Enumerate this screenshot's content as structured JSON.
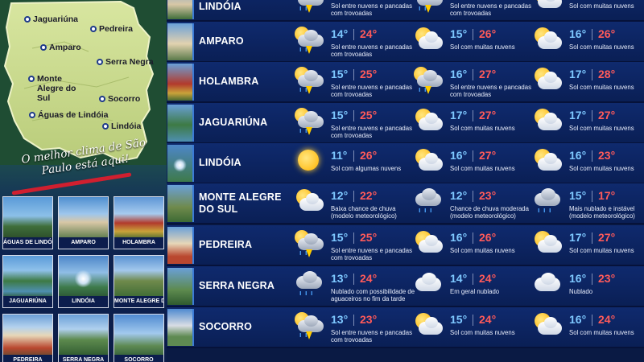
{
  "colors": {
    "min_temp": "#7ec8ff",
    "max_temp": "#ff5a5a",
    "background": "#0a1a44",
    "map_green": "#c8d98a",
    "ribbon": "#d01f2f"
  },
  "map": {
    "cities": [
      "Jaguariúna",
      "Pedreira",
      "Amparo",
      "Serra Negra",
      "Monte Alegre do Sul",
      "Socorro",
      "Águas de Lindóia",
      "Lindóia"
    ]
  },
  "slogan": "O melhor clima de São Paulo está aqui!",
  "thumbnails": [
    "ÁGUAS DE LINDÓIA",
    "AMPARO",
    "HOLAMBRA",
    "JAGUARIÚNA",
    "LINDÓIA",
    "MONTE ALEGRE DO SUL",
    "PEDREIRA",
    "SERRA NEGRA",
    "SOCORRO"
  ],
  "rows": [
    {
      "name": "ÁGUAS DE LINDÓIA",
      "days": [
        {
          "icon": "sun-cloud-storm-icon",
          "min": "",
          "max": "",
          "desc": "Sol entre nuvens e pancadas com trovoadas"
        },
        {
          "icon": "sun-cloud-storm-icon",
          "min": "",
          "max": "",
          "desc": "Sol entre nuvens e pancadas com trovoadas"
        },
        {
          "icon": "sun-cloud-icon",
          "min": "",
          "max": "",
          "desc": "Sol com muitas nuvens"
        }
      ]
    },
    {
      "name": "AMPARO",
      "days": [
        {
          "icon": "sun-cloud-storm-icon",
          "min": "14°",
          "max": "24°",
          "desc": "Sol entre nuvens e pancadas com trovoadas"
        },
        {
          "icon": "sun-cloud-icon",
          "min": "15°",
          "max": "26°",
          "desc": "Sol com muitas nuvens"
        },
        {
          "icon": "sun-cloud-icon",
          "min": "16°",
          "max": "26°",
          "desc": "Sol com muitas nuvens"
        }
      ]
    },
    {
      "name": "HOLAMBRA",
      "days": [
        {
          "icon": "sun-cloud-storm-icon",
          "min": "15°",
          "max": "25°",
          "desc": "Sol entre nuvens e pancadas com trovoadas"
        },
        {
          "icon": "sun-cloud-storm-icon",
          "min": "16°",
          "max": "27°",
          "desc": "Sol entre nuvens e pancadas com trovoadas"
        },
        {
          "icon": "sun-cloud-icon",
          "min": "17°",
          "max": "28°",
          "desc": "Sol com muitas nuvens"
        }
      ]
    },
    {
      "name": "JAGUARIÚNA",
      "days": [
        {
          "icon": "sun-cloud-storm-icon",
          "min": "15°",
          "max": "25°",
          "desc": "Sol entre nuvens e pancadas com trovoadas"
        },
        {
          "icon": "sun-cloud-icon",
          "min": "17°",
          "max": "27°",
          "desc": "Sol com muitas nuvens"
        },
        {
          "icon": "sun-cloud-icon",
          "min": "17°",
          "max": "27°",
          "desc": "Sol com muitas nuvens"
        }
      ]
    },
    {
      "name": "LINDÓIA",
      "days": [
        {
          "icon": "sun-icon",
          "min": "11°",
          "max": "26°",
          "desc": "Sol com algumas nuvens"
        },
        {
          "icon": "sun-cloud-icon",
          "min": "16°",
          "max": "27°",
          "desc": "Sol com muitas nuvens"
        },
        {
          "icon": "sun-cloud-icon",
          "min": "16°",
          "max": "23°",
          "desc": "Sol com muitas nuvens"
        }
      ]
    },
    {
      "name": "MONTE ALEGRE DO SUL",
      "days": [
        {
          "icon": "sun-cloud-icon",
          "min": "12°",
          "max": "22°",
          "desc": "Baixa chance de chuva (modelo meteorológico)"
        },
        {
          "icon": "rain-cloud-icon",
          "min": "12°",
          "max": "23°",
          "desc": "Chance de chuva moderada (modelo meteorológico)"
        },
        {
          "icon": "rain-cloud-icon",
          "min": "15°",
          "max": "17°",
          "desc": "Mais nublado e instável (modelo meteorológico)"
        }
      ]
    },
    {
      "name": "PEDREIRA",
      "days": [
        {
          "icon": "sun-cloud-storm-icon",
          "min": "15°",
          "max": "25°",
          "desc": "Sol entre nuvens e pancadas com trovoadas"
        },
        {
          "icon": "sun-cloud-icon",
          "min": "16°",
          "max": "26°",
          "desc": "Sol com muitas nuvens"
        },
        {
          "icon": "sun-cloud-icon",
          "min": "17°",
          "max": "27°",
          "desc": "Sol com muitas nuvens"
        }
      ]
    },
    {
      "name": "SERRA NEGRA",
      "days": [
        {
          "icon": "rain-cloud-icon",
          "min": "13°",
          "max": "24°",
          "desc": "Nublado com possibilidade de aguaceiros no fim da tarde"
        },
        {
          "icon": "cloud-icon",
          "min": "14°",
          "max": "24°",
          "desc": "Em geral nublado"
        },
        {
          "icon": "cloud-icon",
          "min": "16°",
          "max": "23°",
          "desc": "Nublado"
        }
      ]
    },
    {
      "name": "SOCORRO",
      "days": [
        {
          "icon": "sun-cloud-storm-icon",
          "min": "13°",
          "max": "23°",
          "desc": "Sol entre nuvens e pancadas com trovoadas"
        },
        {
          "icon": "sun-cloud-icon",
          "min": "15°",
          "max": "24°",
          "desc": "Sol com muitas nuvens"
        },
        {
          "icon": "sun-cloud-icon",
          "min": "16°",
          "max": "24°",
          "desc": "Sol com muitas nuvens"
        }
      ]
    }
  ]
}
